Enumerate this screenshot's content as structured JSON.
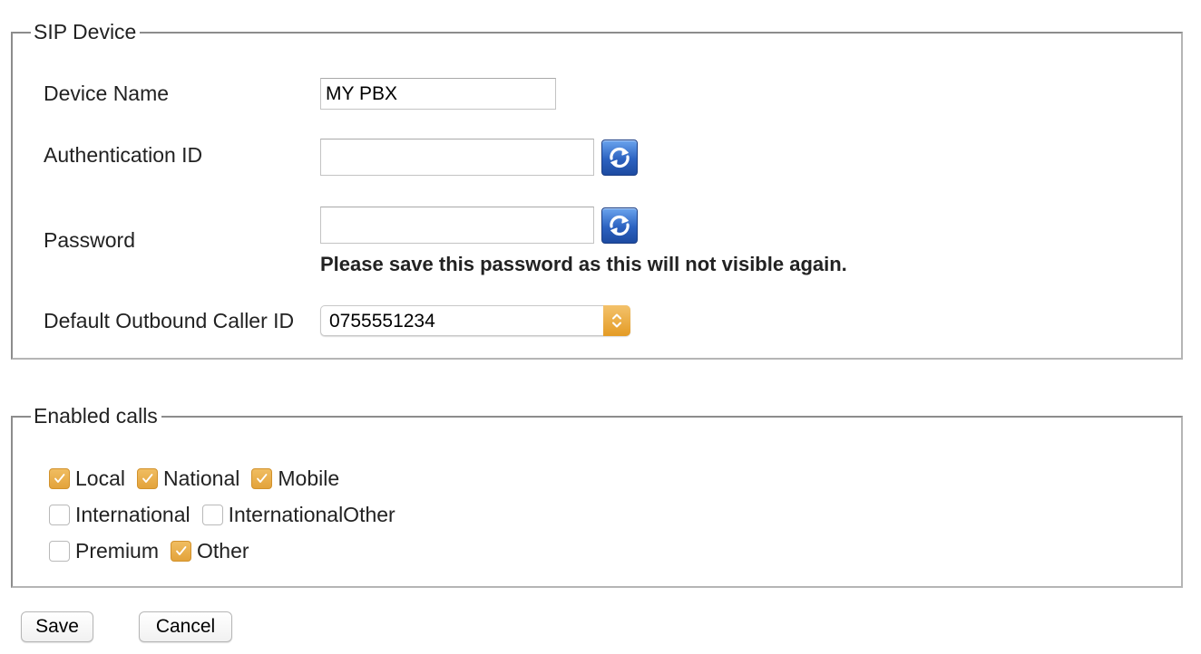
{
  "sip_device": {
    "legend": "SIP Device",
    "device_name": {
      "label": "Device Name",
      "value": "MY PBX"
    },
    "auth_id": {
      "label": "Authentication ID",
      "value": "",
      "refresh_icon": "refresh-icon"
    },
    "password": {
      "label": "Password",
      "value": "",
      "refresh_icon": "refresh-icon",
      "note": "Please save this password as this will not visible again."
    },
    "caller_id": {
      "label": "Default Outbound Caller ID",
      "selected": "0755551234"
    }
  },
  "enabled_calls": {
    "legend": "Enabled calls",
    "options": [
      {
        "label": "Local",
        "checked": true
      },
      {
        "label": "National",
        "checked": true
      },
      {
        "label": "Mobile",
        "checked": true
      },
      {
        "label": "International",
        "checked": false
      },
      {
        "label": "InternationalOther",
        "checked": false
      },
      {
        "label": "Premium",
        "checked": false
      },
      {
        "label": "Other",
        "checked": true
      }
    ]
  },
  "actions": {
    "save": "Save",
    "cancel": "Cancel"
  },
  "colors": {
    "accent": "#e3a33b",
    "refresh": "#2c62c0",
    "border": "#8c8c8c"
  }
}
